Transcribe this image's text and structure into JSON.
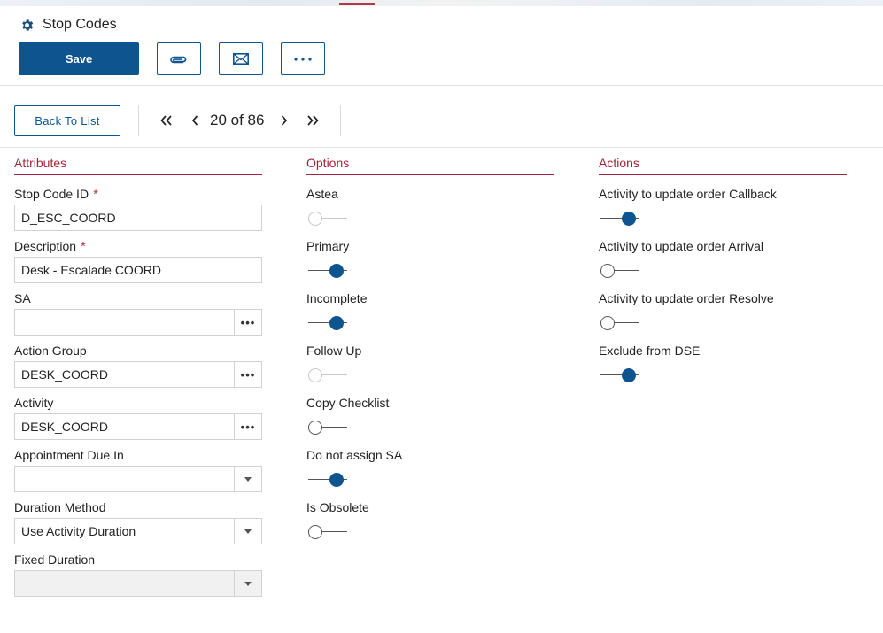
{
  "page": {
    "title": "Stop Codes",
    "icon": "gear-icon"
  },
  "toolbar": {
    "save_label": "Save",
    "attach_icon": "paperclip-icon",
    "email_icon": "envelope-icon",
    "more_icon": "ellipsis-icon"
  },
  "nav": {
    "back_label": "Back To List",
    "pager_text": "20 of 86"
  },
  "attributes": {
    "heading": "Attributes",
    "stop_code_id": {
      "label": "Stop Code ID",
      "value": "D_ESC_COORD",
      "required": "*"
    },
    "description": {
      "label": "Description",
      "value": "Desk - Escalade COORD",
      "required": "*"
    },
    "sa": {
      "label": "SA",
      "value": ""
    },
    "action_group": {
      "label": "Action Group",
      "value": "DESK_COORD"
    },
    "activity": {
      "label": "Activity",
      "value": "DESK_COORD"
    },
    "appointment_due_in": {
      "label": "Appointment Due In",
      "value": ""
    },
    "duration_method": {
      "label": "Duration Method",
      "value": "Use Activity Duration"
    },
    "fixed_duration": {
      "label": "Fixed Duration",
      "value": ""
    }
  },
  "options": {
    "heading": "Options",
    "items": [
      {
        "label": "Astea",
        "state": "off",
        "enabled": false
      },
      {
        "label": "Primary",
        "state": "on",
        "enabled": true
      },
      {
        "label": "Incomplete",
        "state": "on",
        "enabled": true
      },
      {
        "label": "Follow Up",
        "state": "off",
        "enabled": false
      },
      {
        "label": "Copy Checklist",
        "state": "off",
        "enabled": true
      },
      {
        "label": "Do not assign SA",
        "state": "on",
        "enabled": true
      },
      {
        "label": "Is Obsolete",
        "state": "off",
        "enabled": true
      }
    ]
  },
  "actions": {
    "heading": "Actions",
    "items": [
      {
        "label": "Activity to update order Callback",
        "state": "on",
        "enabled": true
      },
      {
        "label": "Activity to update order Arrival",
        "state": "off",
        "enabled": true
      },
      {
        "label": "Activity to update order Resolve",
        "state": "off",
        "enabled": true
      },
      {
        "label": "Exclude from DSE",
        "state": "on",
        "enabled": true
      }
    ]
  },
  "colors": {
    "primary": "#0e5590",
    "accent": "#a5243a"
  }
}
